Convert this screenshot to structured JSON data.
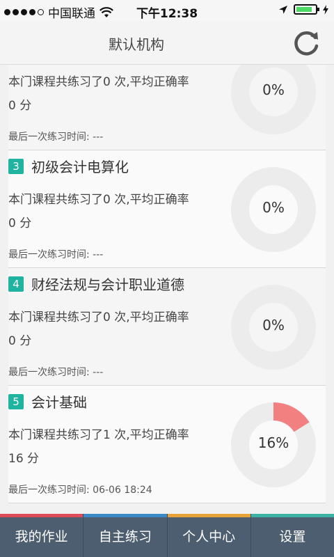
{
  "status_bar": {
    "carrier": "中国联通",
    "time": "下午12:38"
  },
  "nav": {
    "title": "默认机构",
    "refresh_icon": "refresh-icon"
  },
  "courses": [
    {
      "number": "",
      "name": "",
      "stats": "本门课程共练习了0 次,平均正确率",
      "score": "0 分",
      "last_time": "最后一次练习时间: ---",
      "percent_label": "0%",
      "percent": 0
    },
    {
      "number": "3",
      "name": "初级会计电算化",
      "stats": "本门课程共练习了0 次,平均正确率",
      "score": "0 分",
      "last_time": "最后一次练习时间: ---",
      "percent_label": "0%",
      "percent": 0
    },
    {
      "number": "4",
      "name": "财经法规与会计职业道德",
      "stats": "本门课程共练习了0 次,平均正确率",
      "score": "0 分",
      "last_time": "最后一次练习时间: ---",
      "percent_label": "0%",
      "percent": 0
    },
    {
      "number": "5",
      "name": "会计基础",
      "stats": "本门课程共练习了1 次,平均正确率",
      "score": "16 分",
      "last_time": "最后一次练习时间: 06-06 18:24",
      "percent_label": "16%",
      "percent": 16
    }
  ],
  "colors": {
    "badge": "#1fb3a0",
    "progress": "#f38080",
    "ring": "#ececec",
    "tab_bg": "#4d5e71"
  },
  "tabs": [
    {
      "label": "我的作业",
      "accent": "#e04b5a"
    },
    {
      "label": "自主练习",
      "accent": "#3a8ac8"
    },
    {
      "label": "个人中心",
      "accent": "#e8a338"
    },
    {
      "label": "设置",
      "accent": "#3bb3a4"
    }
  ]
}
